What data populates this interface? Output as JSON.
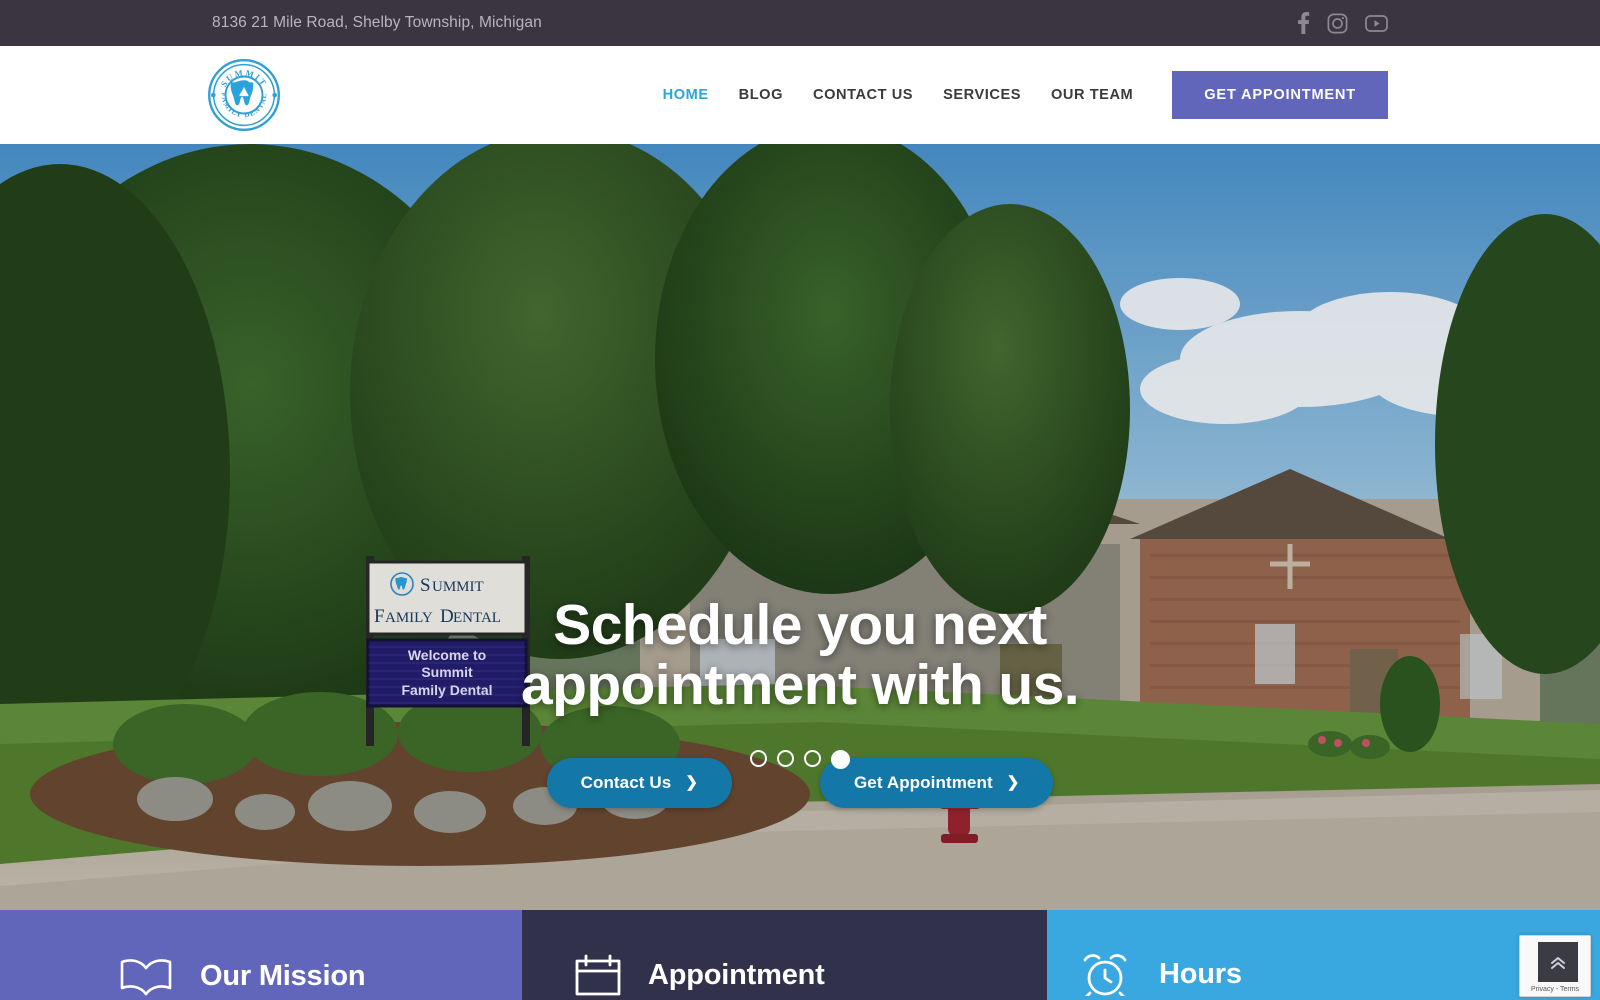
{
  "topbar": {
    "address": "8136 21 Mile Road, Shelby Township, Michigan",
    "social": [
      {
        "name": "facebook-icon",
        "label": "Facebook"
      },
      {
        "name": "instagram-icon",
        "label": "Instagram"
      },
      {
        "name": "youtube-icon",
        "label": "YouTube"
      }
    ]
  },
  "brand": {
    "logo_top_text": "SUMMIT",
    "logo_bottom_text": "FAMILY DENTAL",
    "logo_icon": "tooth-mountain-icon",
    "primary_blue": "#2ba6dd",
    "purple": "#6166bb",
    "navy": "#32314c",
    "sky": "#3aa8e0",
    "teal_button": "#1378a8"
  },
  "nav": {
    "items": [
      {
        "label": "HOME",
        "active": true
      },
      {
        "label": "BLOG",
        "active": false
      },
      {
        "label": "CONTACT US",
        "active": false
      },
      {
        "label": "SERVICES",
        "active": false
      },
      {
        "label": "OUR TEAM",
        "active": false
      }
    ],
    "cta_label": "GET APPOINTMENT"
  },
  "hero": {
    "title": "Schedule you next appointment with us.",
    "buttons": [
      {
        "label": "Contact Us",
        "chevron": "❯"
      },
      {
        "label": "Get Appointment",
        "chevron": "❯"
      }
    ],
    "slides": [
      {
        "active": false
      },
      {
        "active": false
      },
      {
        "active": false
      },
      {
        "active": true
      }
    ],
    "sign": {
      "line1": "SUMMIT",
      "line2": "FAMILY DENTAL",
      "led_line1": "Welcome to",
      "led_line2": "Summit",
      "led_line3": "Family Dental"
    }
  },
  "panels": [
    {
      "title": "Our Mission",
      "icon": "open-book-icon",
      "color": "#6166bb"
    },
    {
      "title": "Appointment",
      "icon": "calendar-icon",
      "color": "#32314c"
    },
    {
      "title": "Hours",
      "icon": "alarm-clock-icon",
      "color": "#3aa8e0"
    }
  ],
  "recaptcha": {
    "terms": "Privacy - Terms",
    "icon": "recaptcha-icon"
  },
  "scrolltop": {
    "icon": "double-chevron-up-icon"
  }
}
